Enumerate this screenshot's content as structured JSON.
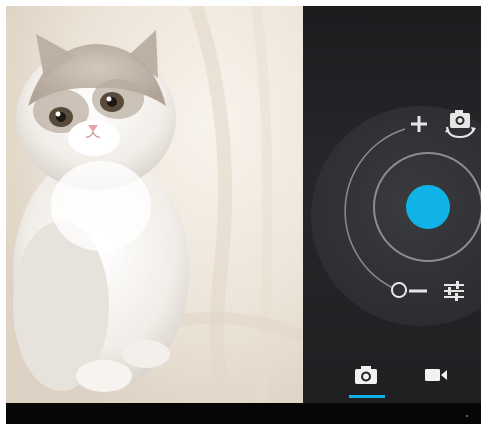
{
  "preview": {
    "subject": "kitten-photo"
  },
  "controls": {
    "zoom_in_icon": "plus-icon",
    "zoom_out_icon": "minus-icon",
    "switch_camera_icon": "camera-switch-icon",
    "settings_icon": "sliders-icon",
    "shutter_icon": "shutter-button"
  },
  "modes": {
    "items": [
      {
        "name": "camera",
        "icon": "camera-icon",
        "selected": true
      },
      {
        "name": "video",
        "icon": "video-camera-icon",
        "selected": false
      }
    ]
  },
  "colors": {
    "accent": "#10b3e6",
    "panel_bg": "#232427",
    "dial_bg": "#2f3033",
    "system_bar": "#060606"
  }
}
